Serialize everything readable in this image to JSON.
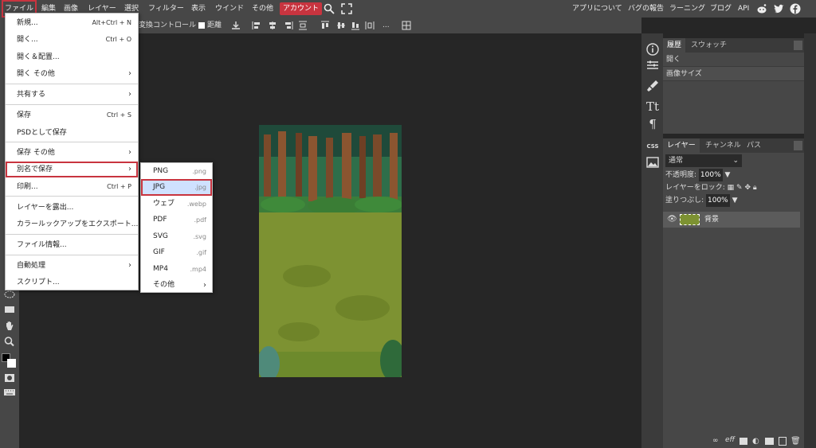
{
  "menubar": {
    "items": [
      "ファイル",
      "編集",
      "画像",
      "レイヤー",
      "選択",
      "フィルター",
      "表示",
      "ウインド",
      "その他"
    ],
    "account": "アカウント",
    "right_links": [
      "アプリについて",
      "バグの報告",
      "ラーニング",
      "ブログ",
      "API"
    ],
    "icons": [
      "search-icon",
      "fullscreen-icon",
      "reddit-icon",
      "twitter-icon",
      "facebook-icon"
    ]
  },
  "optbar": {
    "transform_label": "変換コントロール",
    "distance_label": "距離",
    "more": "..."
  },
  "file_menu": {
    "items": [
      {
        "label": "新規...",
        "shortcut": "Alt+Ctrl + N"
      },
      {
        "label": "開く...",
        "shortcut": "Ctrl + O"
      },
      {
        "label": "開く＆配置..."
      },
      {
        "label": "開く その他",
        "arrow": "›"
      },
      {
        "label": "共有する",
        "arrow": "›"
      },
      {
        "label": "保存",
        "shortcut": "Ctrl + S"
      },
      {
        "label": "PSDとして保存"
      },
      {
        "label": "保存 その他",
        "arrow": "›"
      },
      {
        "label": "別名で保存",
        "arrow": "›"
      },
      {
        "label": "印刷...",
        "shortcut": "Ctrl + P"
      },
      {
        "label": "レイヤーを露出..."
      },
      {
        "label": "カラールックアップをエクスポート..."
      },
      {
        "label": "ファイル情報..."
      },
      {
        "label": "自動処理",
        "arrow": "›"
      },
      {
        "label": "スクリプト..."
      }
    ]
  },
  "save_as_submenu": {
    "items": [
      {
        "label": "PNG",
        "ext": ".png"
      },
      {
        "label": "JPG",
        "ext": ".jpg"
      },
      {
        "label": "ウェブ",
        "ext": ".webp"
      },
      {
        "label": "PDF",
        "ext": ".pdf"
      },
      {
        "label": "SVG",
        "ext": ".svg"
      },
      {
        "label": "GIF",
        "ext": ".gif"
      },
      {
        "label": "MP4",
        "ext": ".mp4"
      },
      {
        "label": "その他",
        "ext": "›"
      }
    ]
  },
  "history_panel": {
    "tabs": [
      "履歴",
      "スウォッチ"
    ],
    "rows": [
      "開く",
      "画像サイズ"
    ]
  },
  "layers_panel": {
    "tabs": [
      "レイヤー",
      "チャンネル",
      "パス"
    ],
    "blend_mode": "通常",
    "opacity_label": "不透明度:",
    "opacity_value": "100%",
    "lock_label": "レイヤーをロック:",
    "fill_label": "塗りつぶし:",
    "fill_value": "100%",
    "layer_name": "背景"
  },
  "right_column": {
    "css_label": "CSS"
  },
  "colors": {
    "accent_red": "#c8343f",
    "selection_blue": "#cfe1ff",
    "chrome": "#474747",
    "workspace": "#262626"
  }
}
